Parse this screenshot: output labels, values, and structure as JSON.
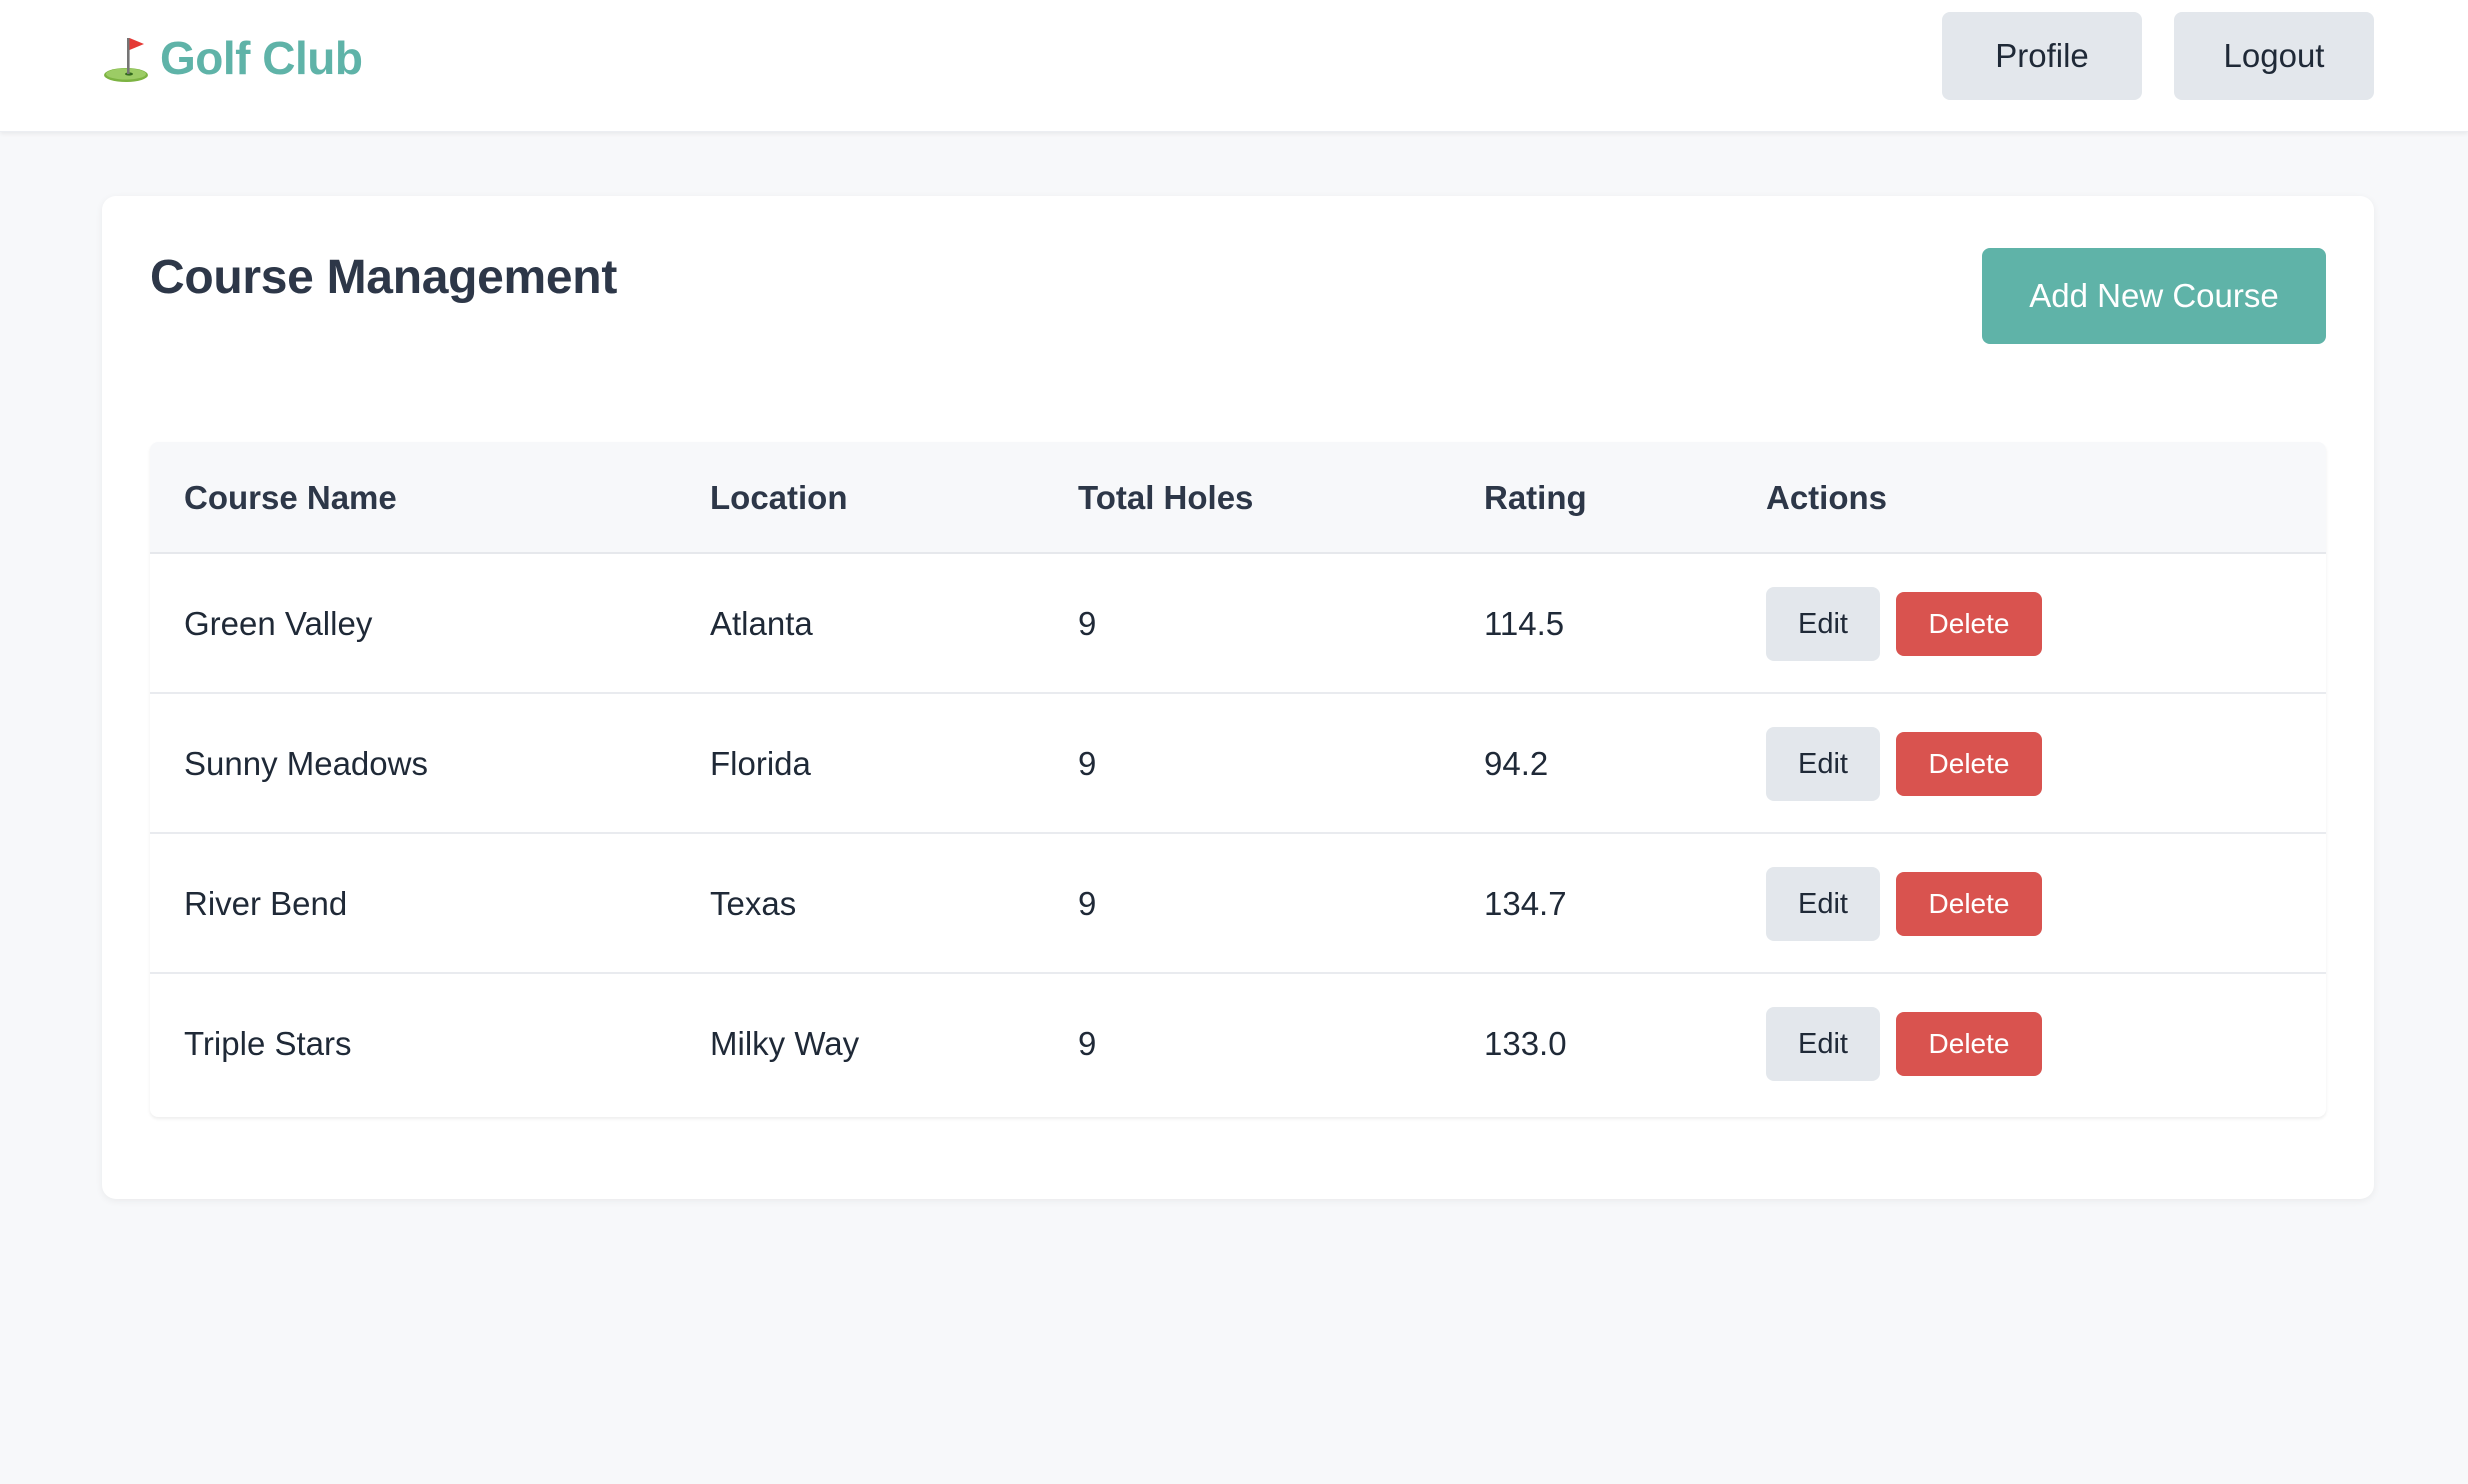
{
  "header": {
    "brand_icon": "golf-flag-icon",
    "brand_name": "Golf Club",
    "brand_color": "#5fb3a8",
    "nav": {
      "profile_label": "Profile",
      "logout_label": "Logout"
    }
  },
  "main": {
    "title": "Course Management",
    "add_button_label": "Add New Course",
    "table": {
      "columns": [
        "Course Name",
        "Location",
        "Total Holes",
        "Rating",
        "Actions"
      ],
      "rows": [
        {
          "name": "Green Valley",
          "location": "Atlanta",
          "holes": "9",
          "rating": "114.5"
        },
        {
          "name": "Sunny Meadows",
          "location": "Florida",
          "holes": "9",
          "rating": "94.2"
        },
        {
          "name": "River Bend",
          "location": "Texas",
          "holes": "9",
          "rating": "134.7"
        },
        {
          "name": "Triple Stars",
          "location": "Milky Way",
          "holes": "9",
          "rating": "133.0"
        }
      ],
      "edit_label": "Edit",
      "delete_label": "Delete",
      "delete_color": "#d9534f"
    }
  }
}
